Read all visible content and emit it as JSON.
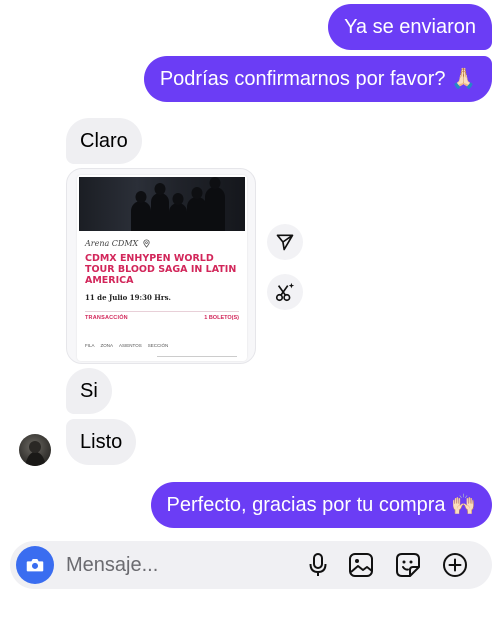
{
  "messages": [
    {
      "id": "m1",
      "from": "me",
      "text": "Ya se enviaron"
    },
    {
      "id": "m2",
      "from": "me",
      "text": "Podrías confirmarnos por favor? 🙏🏻"
    },
    {
      "id": "m3",
      "from": "them",
      "text": "Claro"
    },
    {
      "id": "m4",
      "from": "them",
      "text": "Si"
    },
    {
      "id": "m5",
      "from": "them",
      "text": "Listo"
    },
    {
      "id": "m6",
      "from": "me",
      "text": "Perfecto, gracias por tu compra 🙌🏻"
    }
  ],
  "shared_post": {
    "venue": "Arena CDMX",
    "title": "CDMX ENHYPEN WORLD TOUR BLOOD SAGA IN LATIN AMERICA",
    "date": "11 de Julio 19:30 Hrs.",
    "transaction_label": "TRANSACCIÓN",
    "tickets_label": "1 BOLETO(S)",
    "columns": [
      "FILA",
      "ZONA",
      "ASIENTOS",
      "SECCIÓN"
    ]
  },
  "side_actions": {
    "share_icon": "send-icon",
    "ai_icon": "ai-edit-icon"
  },
  "composer": {
    "placeholder": "Mensaje...",
    "icons": [
      "camera-icon",
      "microphone-icon",
      "gallery-icon",
      "sticker-icon",
      "plus-icon"
    ]
  },
  "colors": {
    "outgoing": "#6b3df5",
    "incoming": "#efeff2",
    "accent_pink": "#d2265a",
    "camera": "#3a6df0"
  }
}
